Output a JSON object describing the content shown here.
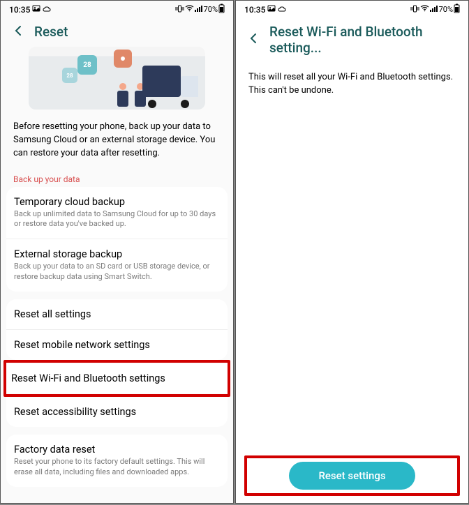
{
  "status": {
    "time": "10:35",
    "battery": "70%"
  },
  "left_screen": {
    "header_title": "Reset",
    "calendar_date": "28",
    "intro": "Before resetting your phone, back up your data to Samsung Cloud or an external storage device. You can restore your data after resetting.",
    "backup_section_label": "Back up your data",
    "backup_options": [
      {
        "title": "Temporary cloud backup",
        "sub": "Back up unlimited data to Samsung Cloud for up to 30 days or restore data you've backed up."
      },
      {
        "title": "External storage backup",
        "sub": "Back up your data to an SD card or USB storage device, or restore backup data using Smart Switch."
      }
    ],
    "reset_options": {
      "reset_all": "Reset all settings",
      "reset_mobile": "Reset mobile network settings",
      "reset_wifi_bt": "Reset Wi-Fi and Bluetooth settings",
      "reset_accessibility": "Reset accessibility settings"
    },
    "factory_reset": {
      "title": "Factory data reset",
      "sub": "Reset your phone to its factory default settings. This will erase all data, including files and downloaded apps."
    }
  },
  "right_screen": {
    "header_title": "Reset Wi-Fi and Bluetooth setting...",
    "description": "This will reset all your Wi-Fi and Bluetooth settings. This can't be undone.",
    "button_label": "Reset settings"
  }
}
